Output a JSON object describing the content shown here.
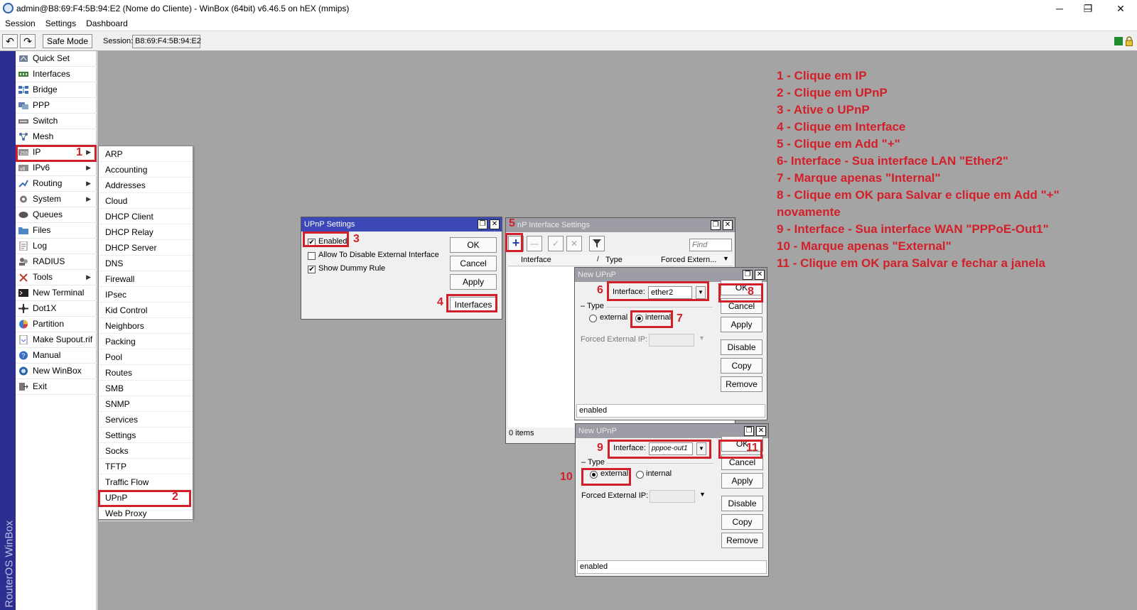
{
  "window": {
    "title": "admin@B8:69:F4:5B:94:E2 (Nome do Cliente) - WinBox (64bit) v6.46.5 on hEX (mmips)",
    "controls": [
      "─",
      "❐",
      "✕"
    ]
  },
  "menubar": [
    "Session",
    "Settings",
    "Dashboard"
  ],
  "toolbar": {
    "undo": "↶",
    "redo": "↷",
    "safe_mode": "Safe Mode",
    "session_label": "Session:",
    "session_value": "B8:69:F4:5B:94:E2"
  },
  "brand_strip": "RouterOS WinBox",
  "sidebar": [
    {
      "label": "Quick Set",
      "icon": "quick-set-icon",
      "sub": false
    },
    {
      "label": "Interfaces",
      "icon": "interfaces-icon",
      "sub": false
    },
    {
      "label": "Bridge",
      "icon": "bridge-icon",
      "sub": false
    },
    {
      "label": "PPP",
      "icon": "ppp-icon",
      "sub": false
    },
    {
      "label": "Switch",
      "icon": "switch-icon",
      "sub": false
    },
    {
      "label": "Mesh",
      "icon": "mesh-icon",
      "sub": false
    },
    {
      "label": "IP",
      "icon": "ip-icon",
      "sub": true
    },
    {
      "label": "IPv6",
      "icon": "ipv6-icon",
      "sub": true
    },
    {
      "label": "Routing",
      "icon": "routing-icon",
      "sub": true
    },
    {
      "label": "System",
      "icon": "system-icon",
      "sub": true
    },
    {
      "label": "Queues",
      "icon": "queues-icon",
      "sub": false
    },
    {
      "label": "Files",
      "icon": "files-icon",
      "sub": false
    },
    {
      "label": "Log",
      "icon": "log-icon",
      "sub": false
    },
    {
      "label": "RADIUS",
      "icon": "radius-icon",
      "sub": false
    },
    {
      "label": "Tools",
      "icon": "tools-icon",
      "sub": true
    },
    {
      "label": "New Terminal",
      "icon": "terminal-icon",
      "sub": false
    },
    {
      "label": "Dot1X",
      "icon": "dot1x-icon",
      "sub": false
    },
    {
      "label": "Partition",
      "icon": "partition-icon",
      "sub": false
    },
    {
      "label": "Make Supout.rif",
      "icon": "supout-icon",
      "sub": false
    },
    {
      "label": "Manual",
      "icon": "manual-icon",
      "sub": false
    },
    {
      "label": "New WinBox",
      "icon": "winbox-icon",
      "sub": false
    },
    {
      "label": "Exit",
      "icon": "exit-icon",
      "sub": false
    }
  ],
  "submenu_ip": [
    "ARP",
    "Accounting",
    "Addresses",
    "Cloud",
    "DHCP Client",
    "DHCP Relay",
    "DHCP Server",
    "DNS",
    "Firewall",
    "IPsec",
    "Kid Control",
    "Neighbors",
    "Packing",
    "Pool",
    "Routes",
    "SMB",
    "SNMP",
    "Services",
    "Settings",
    "Socks",
    "TFTP",
    "Traffic Flow",
    "UPnP",
    "Web Proxy"
  ],
  "upnp_settings": {
    "title": "UPnP Settings",
    "enabled": "Enabled",
    "allow_disable": "Allow To Disable External Interface",
    "dummy_rule": "Show Dummy Rule",
    "ok": "OK",
    "cancel": "Cancel",
    "apply": "Apply",
    "interfaces": "Interfaces"
  },
  "upnp_iface_list": {
    "title": "nP Interface Settings",
    "find_placeholder": "Find",
    "col_interface": "Interface",
    "col_type": "Type",
    "col_forced": "Forced Extern...",
    "footer": "0 items"
  },
  "new_upnp_1": {
    "title": "New UPnP",
    "interface_label": "Interface:",
    "interface_value": "ether2",
    "type_label": "Type",
    "external": "external",
    "internal": "internal",
    "forced_label": "Forced External IP:",
    "status": "enabled",
    "buttons": {
      "ok": "OK",
      "cancel": "Cancel",
      "apply": "Apply",
      "disable": "Disable",
      "copy": "Copy",
      "remove": "Remove"
    }
  },
  "new_upnp_2": {
    "title": "New UPnP",
    "interface_label": "Interface:",
    "interface_value": "pppoe-out1",
    "type_label": "Type",
    "external": "external",
    "internal": "internal",
    "forced_label": "Forced External IP:",
    "status": "enabled",
    "buttons": {
      "ok": "OK",
      "cancel": "Cancel",
      "apply": "Apply",
      "disable": "Disable",
      "copy": "Copy",
      "remove": "Remove"
    }
  },
  "step_numbers": [
    "1",
    "2",
    "3",
    "4",
    "5",
    "6",
    "7",
    "8",
    "9",
    "10",
    "11"
  ],
  "instructions": [
    "1 - Clique em IP",
    "2 - Clique em UPnP",
    "3 - Ative o UPnP",
    "4 - Clique em Interface",
    "5 - Clique em Add \"+\"",
    "6- Interface - Sua interface LAN \"Ether2\"",
    "7 - Marque apenas \"Internal\"",
    "8 - Clique em OK para Salvar e clique em Add \"+\"",
    "novamente",
    "9 - Interface - Sua interface WAN \"PPPoE-Out1\"",
    "10 - Marque apenas \"External\"",
    "11 - Clique em OK para Salvar e fechar a janela"
  ],
  "colors": {
    "annotation": "#d31f2a",
    "active_title": "#3c48b8",
    "strip": "#2c2f8f",
    "desktop": "#a4a4a4"
  }
}
